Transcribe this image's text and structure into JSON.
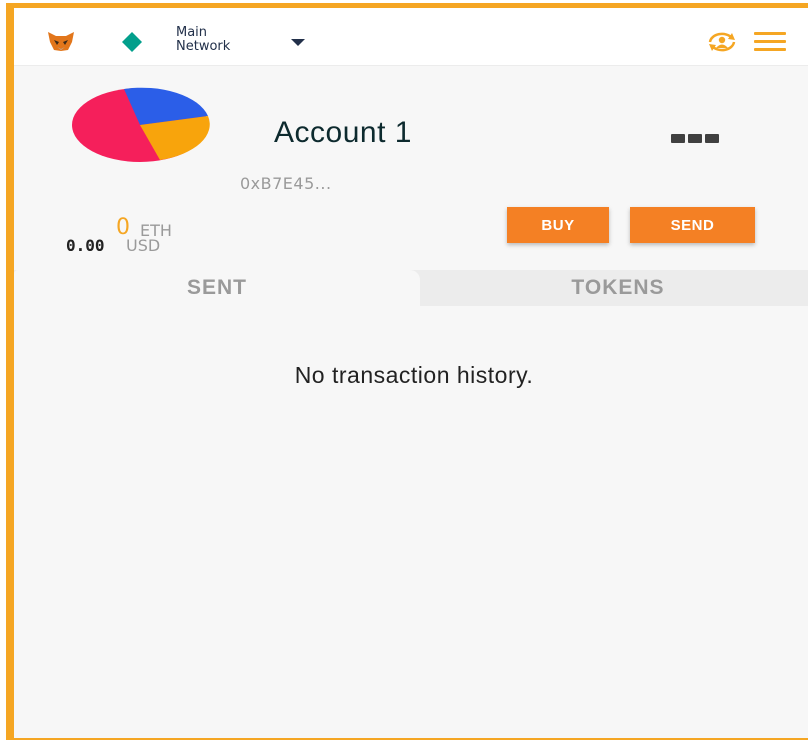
{
  "header": {
    "network_line1": "Main",
    "network_line2": "Network",
    "icons": [
      "fox-icon",
      "network-diamond-icon",
      "caret-down-icon",
      "account-switch-icon",
      "hamburger-menu-icon"
    ]
  },
  "account": {
    "name": "Account 1",
    "address": "0xB7E45...",
    "identicon_colors": [
      "#f51f5b",
      "#2b5ee8",
      "#f8a40c"
    ]
  },
  "balance": {
    "eth_amount": "0",
    "eth_unit": "ETH",
    "usd_amount": "0.00",
    "usd_unit": "USD"
  },
  "actions": {
    "buy_label": "BUY",
    "send_label": "SEND"
  },
  "tabs": [
    {
      "label": "SENT",
      "active": true
    },
    {
      "label": "TOKENS",
      "active": false
    }
  ],
  "transactions": {
    "empty_message": "No transaction history."
  },
  "colors": {
    "accent": "#f5a623",
    "button": "#f48024",
    "text_dark": "#0d2a2e",
    "muted": "#9a9a9a"
  }
}
